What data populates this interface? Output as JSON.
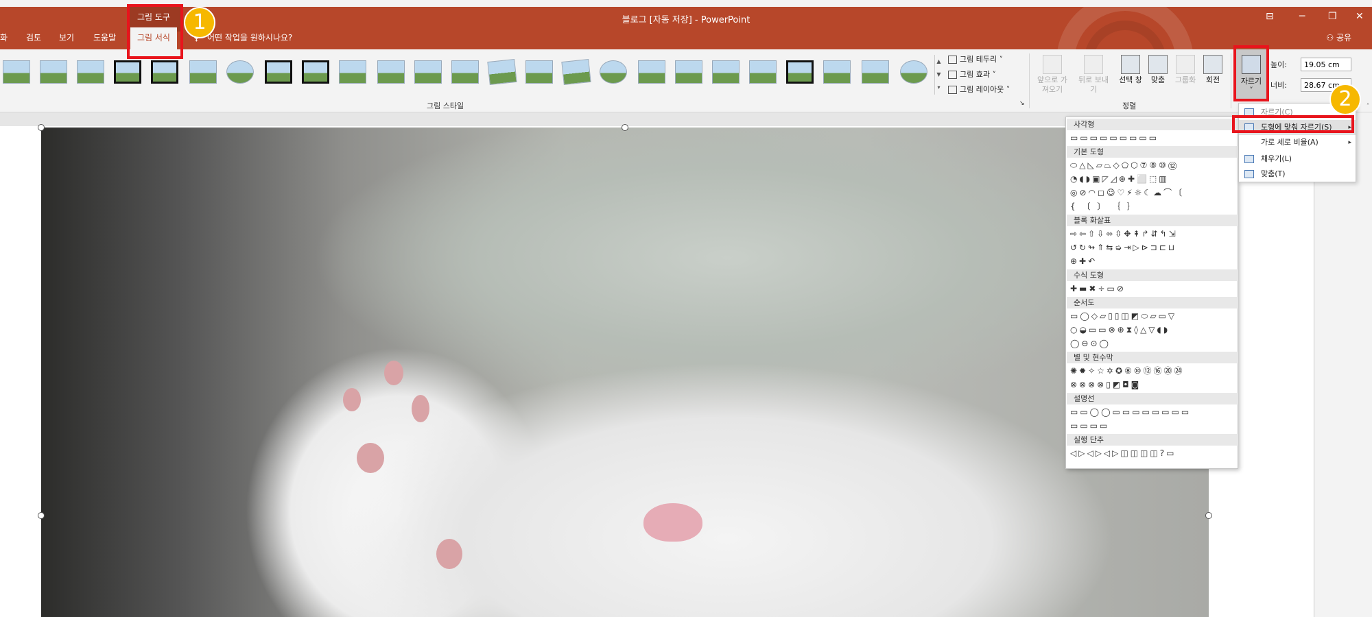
{
  "window": {
    "title": "블로그 [자동 저장]  -  PowerPoint",
    "context_group": "그림 도구",
    "share_label": "공유"
  },
  "tabs": [
    {
      "label": "화"
    },
    {
      "label": "검토"
    },
    {
      "label": "보기"
    },
    {
      "label": "도움말"
    },
    {
      "label": "그림 서식"
    },
    {
      "label": "어떤 작업을 원하시나요?"
    }
  ],
  "ribbon": {
    "picture_styles_label": "그림 스타일",
    "arrange_label": "정렬",
    "border_label": "그림 테두리",
    "effects_label": "그림 효과",
    "layout_label": "그림 레이아웃",
    "bring_forward": "앞으로 가져오기",
    "send_backward": "뒤로 보내기",
    "selection_pane": "선택 창",
    "align": "맞춤",
    "group": "그룹화",
    "rotate": "회전",
    "crop_label": "자르기",
    "height_label": "높이:",
    "height_value": "19.05 cm",
    "width_label": "너비:",
    "width_value": "28.67 cm"
  },
  "badges": {
    "step1": "1",
    "step2": "2"
  },
  "crop_menu": {
    "items": [
      {
        "label": "자르기(C)"
      },
      {
        "label": "도형에 맞춰 자르기(S)"
      },
      {
        "label": "가로 세로 비율(A)"
      },
      {
        "label": "채우기(L)"
      },
      {
        "label": "맞춤(T)"
      }
    ]
  },
  "shapes_flyout": {
    "sections": [
      {
        "title": "사각형",
        "rows": [
          "▭▭▭▭▭▭▭▭▭"
        ]
      },
      {
        "title": "기본 도형",
        "rows": [
          "⬭△◺▱⏢◇⬠⬡⑦⑧⑩⑫",
          "◔◖◗▣◸◿⊕✚⬜⬚▥",
          "◎⊘◠◻☺♡⚡☼☾☁⌒〔",
          "{ 〔 〕 ｛ ｝"
        ]
      },
      {
        "title": "블록 화살표",
        "rows": [
          "⇨⇦⇧⇩⬄⇳✥⇞↱⇵↰⇲",
          "↺↻↬⇑⇆➭⇥▷⊳⊐⊏⊔",
          "⊕✚↶"
        ]
      },
      {
        "title": "수식 도형",
        "rows": [
          "✚▬✖÷▭⊘"
        ]
      },
      {
        "title": "순서도",
        "rows": [
          "▭◯◇▱▯▯◫◩⬭▱▭▽",
          "○◒▭▭⊗⊕⧗◊△▽◖◗",
          "◯⊖⊙◯"
        ]
      },
      {
        "title": "별 및 현수막",
        "rows": [
          "✺✹✧☆✡✪⑧⑩⑫⑯⑳㉔",
          "⊗⊗⊗⊗▯◩◘◙"
        ]
      },
      {
        "title": "설명선",
        "rows": [
          "▭▭◯◯▭▭▭▭▭▭▭▭",
          "▭▭▭▭"
        ]
      },
      {
        "title": "실행 단추",
        "rows": [
          "◁▷◁▷◁▷◫◫◫◫?▭"
        ]
      }
    ]
  }
}
